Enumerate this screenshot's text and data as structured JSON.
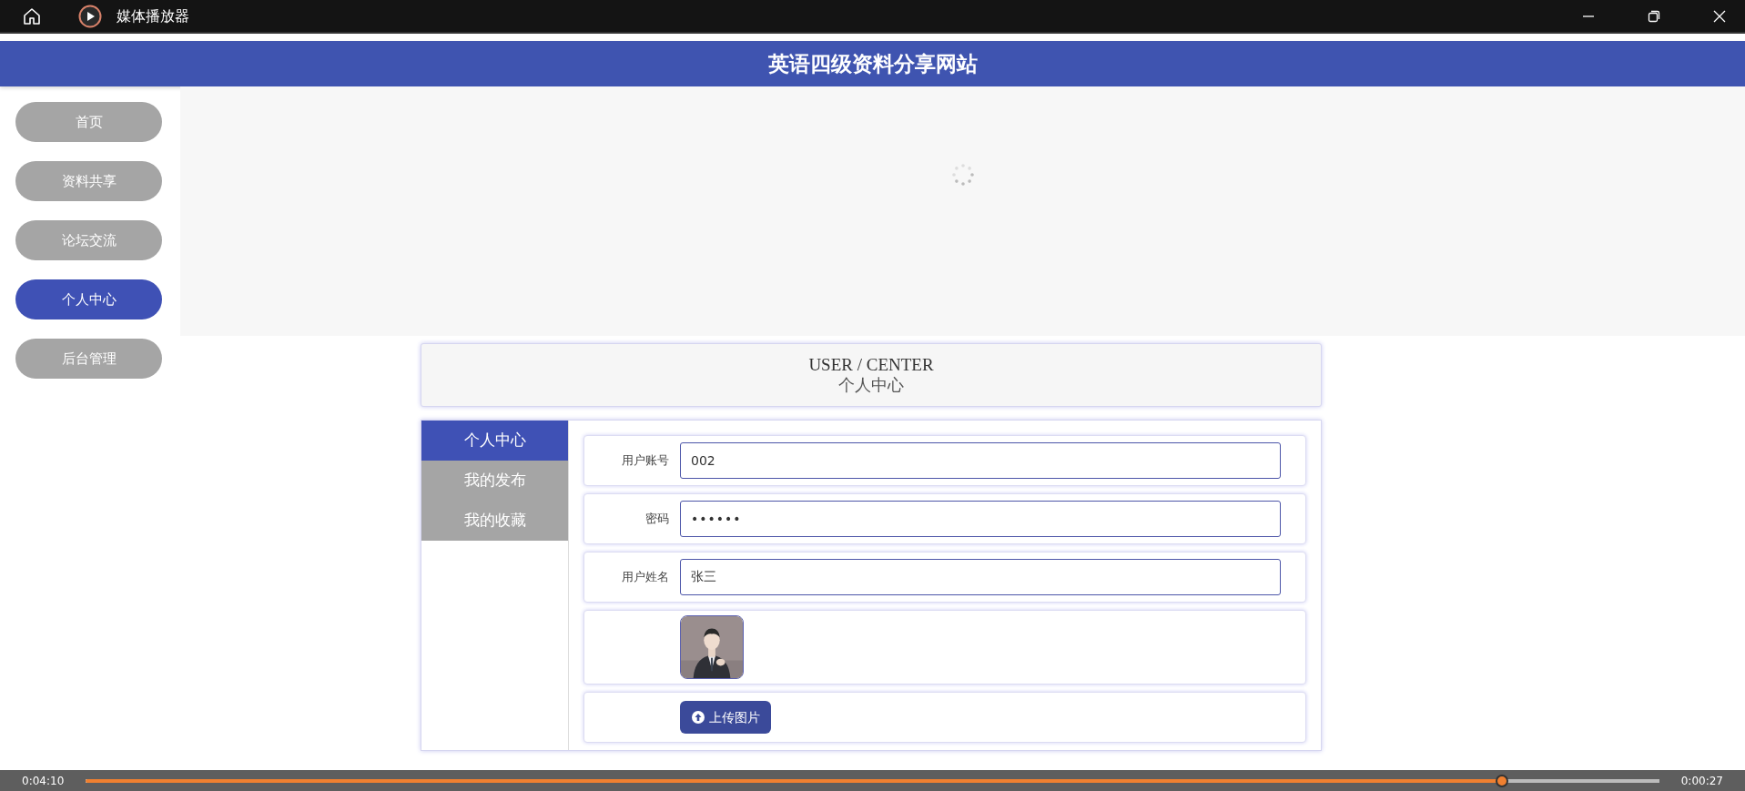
{
  "window": {
    "title": "媒体播放器"
  },
  "site": {
    "title": "英语四级资料分享网站"
  },
  "nav": [
    {
      "label": "首页",
      "selected": false
    },
    {
      "label": "资料共享",
      "selected": false
    },
    {
      "label": "论坛交流",
      "selected": false
    },
    {
      "label": "个人中心",
      "selected": true
    },
    {
      "label": "后台管理",
      "selected": false
    }
  ],
  "page_header": {
    "title_en": "USER / CENTER",
    "title": "个人中心"
  },
  "tabs": [
    {
      "label": "个人中心",
      "selected": true
    },
    {
      "label": "我的发布",
      "selected": false
    },
    {
      "label": "我的收藏",
      "selected": false
    }
  ],
  "form": {
    "fields": [
      {
        "label": "用户账号",
        "value": "002",
        "kind": "text"
      },
      {
        "label": "密码",
        "value": "••••••",
        "kind": "password"
      },
      {
        "label": "用户姓名",
        "value": "张三",
        "kind": "text"
      }
    ],
    "upload_button": "上传图片"
  },
  "player": {
    "elapsed": "0:04:10",
    "remaining": "0:00:27",
    "level": 0.9
  }
}
